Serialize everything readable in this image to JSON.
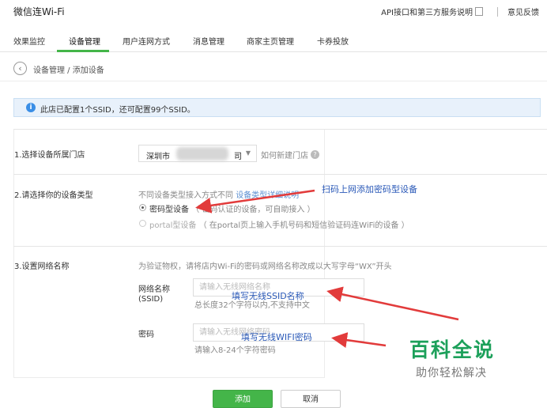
{
  "app": {
    "title": "微信连Wi-Fi",
    "api_link": "API接口和第三方服务说明",
    "feedback_link": "意见反馈"
  },
  "tabs": [
    {
      "label": "效果监控",
      "active": false
    },
    {
      "label": "设备管理",
      "active": true
    },
    {
      "label": "用户连网方式",
      "active": false
    },
    {
      "label": "消息管理",
      "active": false
    },
    {
      "label": "商家主页管理",
      "active": false
    },
    {
      "label": "卡券投放",
      "active": false
    }
  ],
  "breadcrumb": "设备管理 / 添加设备",
  "info_notice": "此店已配置1个SSID，还可配置99个SSID。",
  "form": {
    "step1": {
      "label": "1.选择设备所属门店",
      "store_prefix": "深圳市",
      "store_suffix": "司",
      "create_store_link": "如何新建门店"
    },
    "step2": {
      "label": "2.请选择你的设备类型",
      "desc_text": "不同设备类型接入方式不同",
      "desc_link": "设备类型详细说明",
      "option_password_label": "密码型设备",
      "option_password_hint": "（ 密码认证的设备，可自助接入 ）",
      "option_portal_label": "portal型设备",
      "option_portal_hint": "（ 在portal页上输入手机号码和短信验证码连WiFi的设备 ）"
    },
    "step3": {
      "label": "3.设置网络名称",
      "desc": "为验证物权，请将店内Wi-Fi的密码或网络名称改成以大写字母“WX”开头",
      "ssid_label_line1": "网络名称",
      "ssid_label_line2": "(SSID)",
      "ssid_placeholder": "请输入无线网络名称",
      "ssid_hint": "总长度32个字符以内,不支持中文",
      "password_label": "密码",
      "password_placeholder": "请输入无线网络密码",
      "password_hint": "请输入8-24个字符密码"
    },
    "add_button": "添加",
    "cancel_button": "取消"
  },
  "annotations": {
    "scan_add": "扫码上网添加密码型设备",
    "fill_ssid": "填写无线SSID名称",
    "fill_wifi_password": "填写无线WIFI密码"
  },
  "watermark": {
    "main": "百科全说",
    "sub": "助你轻松解决"
  },
  "colors": {
    "accent_green": "#44b549",
    "annotation_red": "#e23b3b",
    "annotation_blue": "#2a59b8",
    "info_blue": "#3a8ee6"
  }
}
